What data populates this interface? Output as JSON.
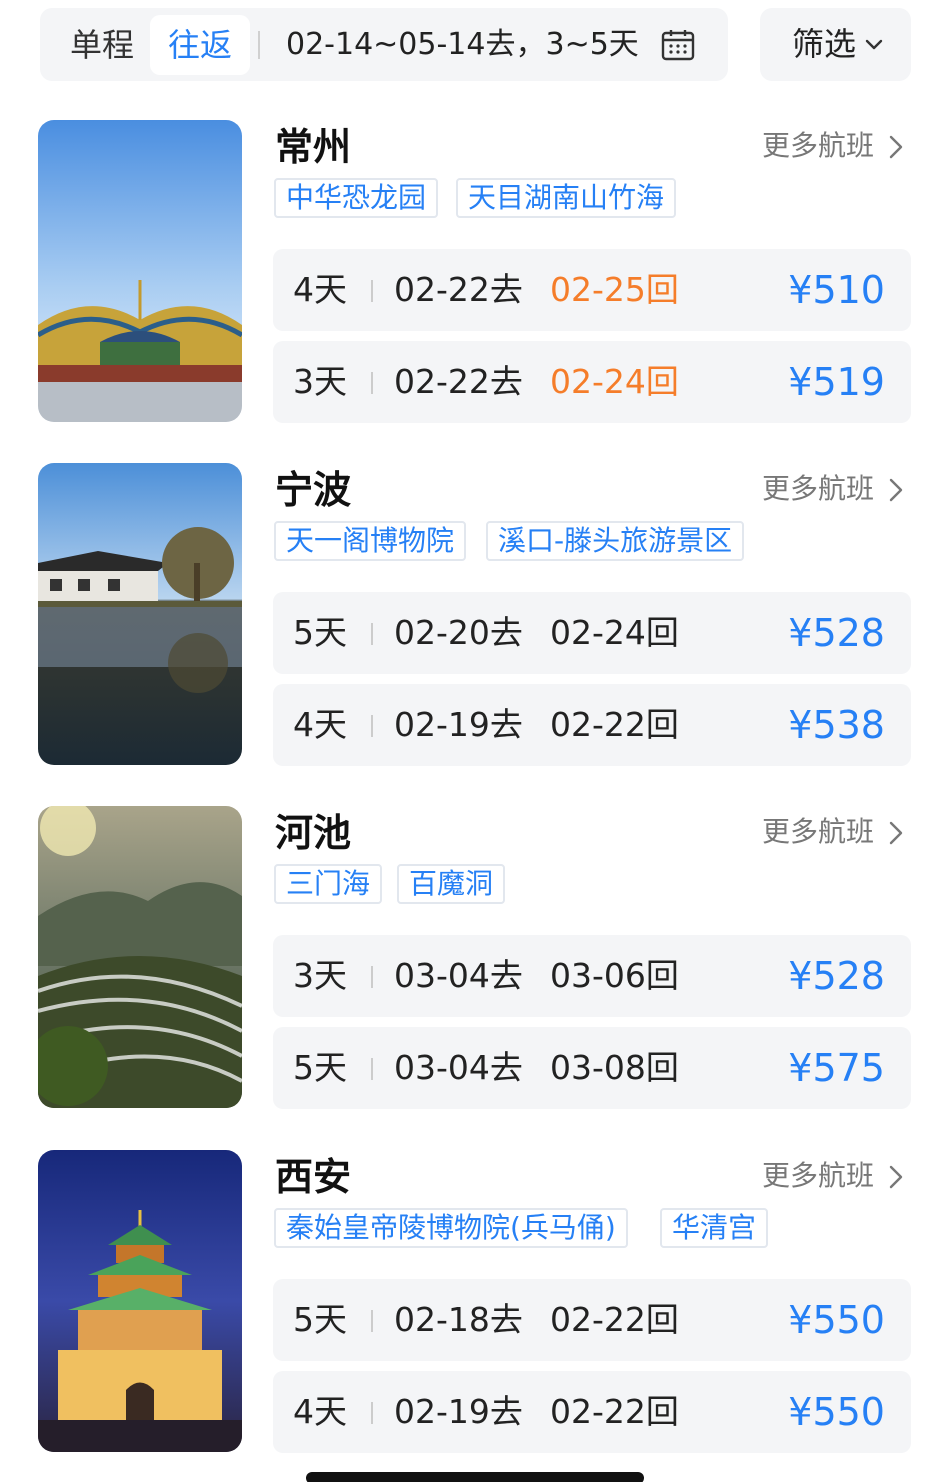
{
  "search_bar": {
    "tab_oneway": "单程",
    "tab_roundtrip": "往返",
    "date_range": "02-14~05-14去，3~5天",
    "filter_label": "筛选",
    "active_tab": "往返"
  },
  "colors": {
    "accent": "#2680f5",
    "highlight": "#f57d2a",
    "card_bg": "#f4f5f7"
  },
  "destinations": [
    {
      "city": "常州",
      "more_label": "更多航班",
      "tags": [
        "中华恐龙园",
        "天目湖南山竹海"
      ],
      "flights": [
        {
          "days": "4天",
          "depart": "02-22去",
          "return_date": "02-25",
          "return_suffix": "回",
          "price": "¥510",
          "return_highlighted": true
        },
        {
          "days": "3天",
          "depart": "02-22去",
          "return_date": "02-24",
          "return_suffix": "回",
          "price": "¥519",
          "return_highlighted": true
        }
      ]
    },
    {
      "city": "宁波",
      "more_label": "更多航班",
      "tags": [
        "天一阁博物院",
        "溪口-滕头旅游景区"
      ],
      "flights": [
        {
          "days": "5天",
          "depart": "02-20去",
          "return_date": "02-24",
          "return_suffix": "回",
          "price": "¥528",
          "return_highlighted": false
        },
        {
          "days": "4天",
          "depart": "02-19去",
          "return_date": "02-22",
          "return_suffix": "回",
          "price": "¥538",
          "return_highlighted": false
        }
      ]
    },
    {
      "city": "河池",
      "more_label": "更多航班",
      "tags": [
        "三门海",
        "百魔洞"
      ],
      "flights": [
        {
          "days": "3天",
          "depart": "03-04去",
          "return_date": "03-06",
          "return_suffix": "回",
          "price": "¥528",
          "return_highlighted": false
        },
        {
          "days": "5天",
          "depart": "03-04去",
          "return_date": "03-08",
          "return_suffix": "回",
          "price": "¥575",
          "return_highlighted": false
        }
      ]
    },
    {
      "city": "西安",
      "more_label": "更多航班",
      "tags": [
        "秦始皇帝陵博物院(兵马俑)",
        "华清宫"
      ],
      "flights": [
        {
          "days": "5天",
          "depart": "02-18去",
          "return_date": "02-22",
          "return_suffix": "回",
          "price": "¥550",
          "return_highlighted": false
        },
        {
          "days": "4天",
          "depart": "02-19去",
          "return_date": "02-22",
          "return_suffix": "回",
          "price": "¥550",
          "return_highlighted": false
        }
      ]
    }
  ]
}
